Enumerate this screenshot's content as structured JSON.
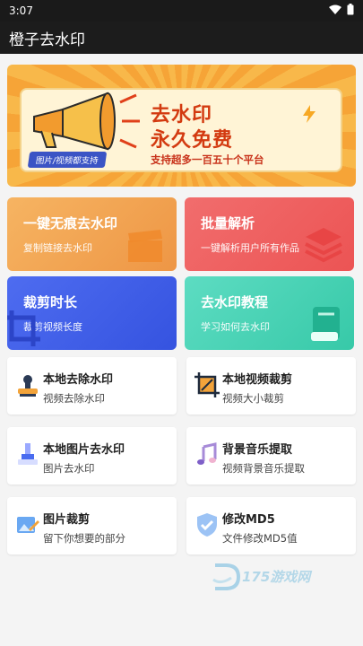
{
  "status_bar": {
    "time": "3:07"
  },
  "app": {
    "title": "橙子去水印"
  },
  "banner": {
    "title_line1": "去水印",
    "title_line2": "永久免费",
    "subtitle": "支持超多一百五十个平台",
    "tag": "图片/视频都支持"
  },
  "big_cards": [
    {
      "title": "一键无痕去水印",
      "subtitle": "复制链接去水印",
      "color": "#f1a455",
      "icon": "film-clapper-icon"
    },
    {
      "title": "批量解析",
      "subtitle": "一键解析用户所有作品",
      "color": "#ee5f5f",
      "icon": "layers-icon"
    },
    {
      "title": "裁剪时长",
      "subtitle": "裁剪视频长度",
      "color": "#3d5de8",
      "icon": "crop-icon"
    },
    {
      "title": "去水印教程",
      "subtitle": "学习如何去水印",
      "color": "#3fd1b2",
      "icon": "book-icon"
    }
  ],
  "tools": [
    {
      "title": "本地去除水印",
      "subtitle": "视频去除水印",
      "icon": "stamp-icon"
    },
    {
      "title": "本地视频裁剪",
      "subtitle": "视频大小裁剪",
      "icon": "crop-frame-icon"
    },
    {
      "title": "本地图片去水印",
      "subtitle": "图片去水印",
      "icon": "image-stamp-icon"
    },
    {
      "title": "背景音乐提取",
      "subtitle": "视频背景音乐提取",
      "icon": "music-note-icon"
    },
    {
      "title": "图片裁剪",
      "subtitle": "留下你想要的部分",
      "icon": "image-edit-icon"
    },
    {
      "title": "修改MD5",
      "subtitle": "文件修改MD5值",
      "icon": "shield-icon"
    }
  ],
  "watermark": {
    "text": "175游戏网"
  }
}
